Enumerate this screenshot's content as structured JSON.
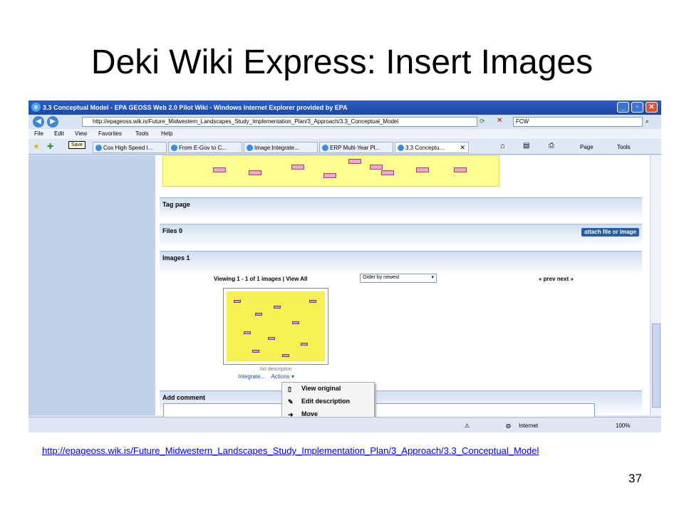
{
  "slide": {
    "title": "Deki Wiki Express: Insert Images",
    "footer_link": "http://epageoss.wik.is/Future_Midwestern_Landscapes_Study_Implementation_Plan/3_Approach/3.3_Conceptual_Model",
    "page_number": "37"
  },
  "browser": {
    "window_title": "3.3 Conceptual Model - EPA GEOSS Web 2.0 Pilot Wiki - Windows Internet Explorer provided by EPA",
    "address": "http://epageoss.wik.is/Future_Midwestern_Landscapes_Study_Implementation_Plan/3_Approach/3.3_Conceptual_Model",
    "search_value": "FCW",
    "menu": [
      "File",
      "Edit",
      "View",
      "Favorites",
      "Tools",
      "Help"
    ],
    "tooltip": "Save",
    "tabs": [
      {
        "label": "Cox High Speed I..."
      },
      {
        "label": "From E-Gov to C..."
      },
      {
        "label": "Image:Integrate..."
      },
      {
        "label": "ERP Multi-Year Pl..."
      },
      {
        "label": "3.3 Conceptu..."
      }
    ],
    "command_bar": {
      "page": "Page",
      "tools": "Tools"
    },
    "status": {
      "zone": "Internet",
      "zoom": "100%"
    }
  },
  "wiki": {
    "tag_page": "Tag page",
    "files_label": "Files 0",
    "attach_button": "attach file or image",
    "images_label": "Images 1",
    "viewing_text": "Viewing 1 - 1 of 1 images | View All",
    "order_by": "Order by newest",
    "prev_next": "« prev next »",
    "no_description": "No description",
    "integrate_link": "Integrate...",
    "actions_link": "Actions",
    "actions_menu": [
      "View original",
      "Edit description",
      "Move"
    ],
    "add_comment": "Add comment"
  },
  "colors": {
    "accent": "#2a5d9a",
    "title_bar": "#1b47a8",
    "diagram_bg": "#fffe8e"
  }
}
